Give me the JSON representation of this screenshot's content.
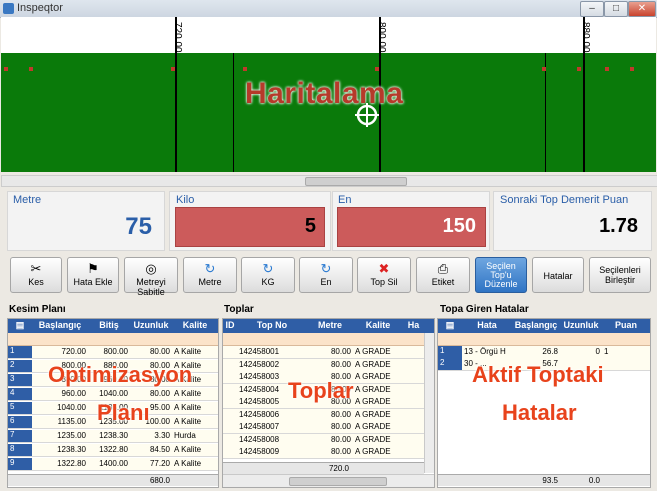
{
  "window": {
    "title": "Inspeqtor",
    "min": "–",
    "max": "□",
    "close": "✕"
  },
  "map": {
    "title": "Haritalama",
    "ruler": [
      "720.00",
      "800.00",
      "880.00"
    ]
  },
  "stats": {
    "metre": {
      "label": "Metre",
      "value": "75"
    },
    "kilo": {
      "label": "Kilo",
      "value": "5"
    },
    "en": {
      "label": "En",
      "value": "150"
    },
    "sonraki": {
      "label": "Sonraki Top Demerit Puan",
      "value": "1.78"
    }
  },
  "toolbar": {
    "kes": "Kes",
    "hata_ekle": "Hata Ekle",
    "metreyi_sabitle": "Metreyi Sabitle",
    "metre": "Metre",
    "kg": "KG",
    "en": "En",
    "top_sil": "Top Sil",
    "etiket": "Etiket",
    "secilen_duzenle": "Seçilen Top'u Düzenle",
    "hatalar": "Hatalar",
    "birlestir": "Seçilenleri Birleştir"
  },
  "kesim": {
    "title": "Kesim Planı",
    "overlay1": "Optimizasyon",
    "overlay2": "Planı",
    "columns": [
      "Başlangıç",
      "Bitiş",
      "Uzunluk",
      "Kalite"
    ],
    "rows": [
      {
        "n": "1",
        "b": "720.00",
        "e": "800.00",
        "u": "80.00",
        "k": "A Kalite"
      },
      {
        "n": "2",
        "b": "800.00",
        "e": "880.00",
        "u": "80.00",
        "k": "A Kalite"
      },
      {
        "n": "3",
        "b": "880.00",
        "e": "960.00",
        "u": "80.00",
        "k": "A Kalite"
      },
      {
        "n": "4",
        "b": "960.00",
        "e": "1040.00",
        "u": "80.00",
        "k": "A Kalite"
      },
      {
        "n": "5",
        "b": "1040.00",
        "e": "1135.00",
        "u": "95.00",
        "k": "A Kalite"
      },
      {
        "n": "6",
        "b": "1135.00",
        "e": "1235.00",
        "u": "100.00",
        "k": "A Kalite"
      },
      {
        "n": "7",
        "b": "1235.00",
        "e": "1238.30",
        "u": "3.30",
        "k": "Hurda"
      },
      {
        "n": "8",
        "b": "1238.30",
        "e": "1322.80",
        "u": "84.50",
        "k": "A Kalite"
      },
      {
        "n": "9",
        "b": "1322.80",
        "e": "1400.00",
        "u": "77.20",
        "k": "A Kalite"
      }
    ],
    "total": "680.0"
  },
  "toplar": {
    "title": "Toplar",
    "overlay": "Toplar",
    "columns": [
      "ID",
      "Top No",
      "Metre",
      "Kalite",
      "Ha"
    ],
    "rows": [
      {
        "no": "142458001",
        "m": "80.00",
        "k": "A GRADE"
      },
      {
        "no": "142458002",
        "m": "80.00",
        "k": "A GRADE"
      },
      {
        "no": "142458003",
        "m": "80.00",
        "k": "A GRADE"
      },
      {
        "no": "142458004",
        "m": "80.00",
        "k": "A GRADE"
      },
      {
        "no": "142458005",
        "m": "80.00",
        "k": "A GRADE"
      },
      {
        "no": "142458006",
        "m": "80.00",
        "k": "A GRADE"
      },
      {
        "no": "142458007",
        "m": "80.00",
        "k": "A GRADE"
      },
      {
        "no": "142458008",
        "m": "80.00",
        "k": "A GRADE"
      },
      {
        "no": "142458009",
        "m": "80.00",
        "k": "A GRADE"
      }
    ],
    "total": "720.0"
  },
  "hatalar": {
    "title": "Topa Giren Hatalar",
    "overlay1": "Aktif Toptaki",
    "overlay2": "Hatalar",
    "columns": [
      "Hata",
      "Başlangıç",
      "Uzunluk",
      "Puan"
    ],
    "rows": [
      {
        "n": "1",
        "h": "13 - Örgü H",
        "b": "26.8",
        "u": "0",
        "p": "1"
      },
      {
        "n": "2",
        "h": "30 - ...",
        "b": "56.7",
        "u": "",
        "p": ""
      }
    ],
    "total_b": "93.5",
    "total_u": "0.0"
  }
}
